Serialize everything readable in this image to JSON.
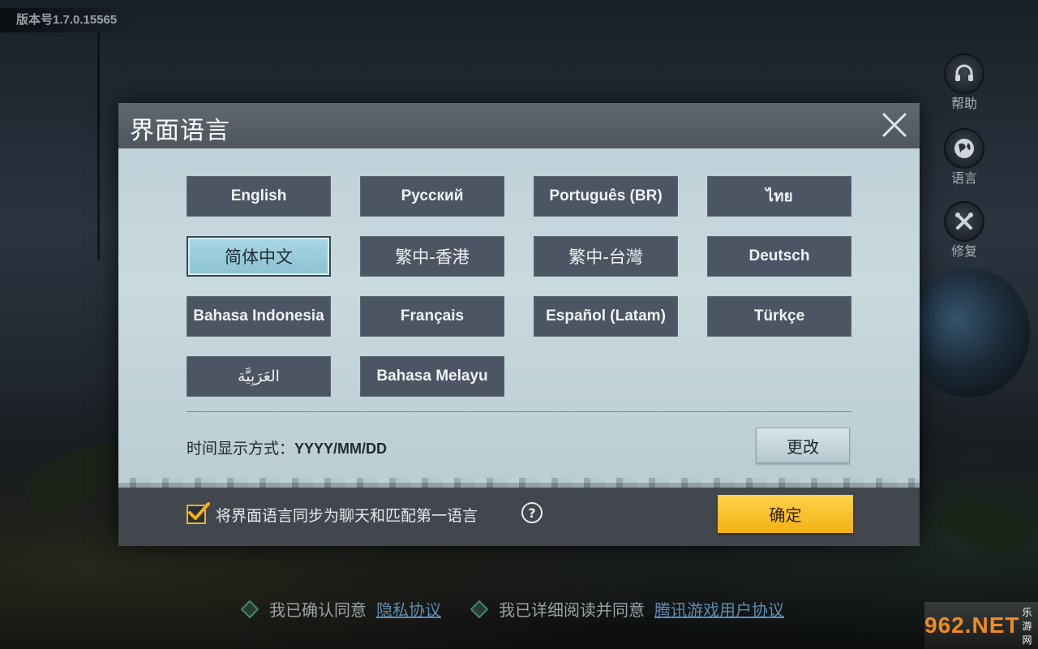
{
  "version": "版本号1.7.0.15565",
  "side_tools": [
    {
      "label": "帮助",
      "icon": "headset-icon"
    },
    {
      "label": "语言",
      "icon": "globe-icon"
    },
    {
      "label": "修复",
      "icon": "wrench-icon"
    }
  ],
  "dialog": {
    "title": "界面语言",
    "languages": [
      {
        "label": "English",
        "selected": false
      },
      {
        "label": "Русский",
        "selected": false
      },
      {
        "label": "Português (BR)",
        "selected": false
      },
      {
        "label": "ไทย",
        "selected": false
      },
      {
        "label": "简体中文",
        "selected": true
      },
      {
        "label": "繁中-香港",
        "selected": false
      },
      {
        "label": "繁中-台灣",
        "selected": false
      },
      {
        "label": "Deutsch",
        "selected": false
      },
      {
        "label": "Bahasa Indonesia",
        "selected": false
      },
      {
        "label": "Français",
        "selected": false
      },
      {
        "label": "Español (Latam)",
        "selected": false
      },
      {
        "label": "Türkçe",
        "selected": false
      },
      {
        "label": "العَرَبِيَّة",
        "selected": false
      },
      {
        "label": "Bahasa Melayu",
        "selected": false
      }
    ],
    "date_format_label": "时间显示方式：",
    "date_format_value": "YYYY/MM/DD",
    "change_label": "更改",
    "sync_label": "将界面语言同步为聊天和匹配第一语言",
    "sync_checked": true,
    "help_symbol": "?",
    "confirm_label": "确定"
  },
  "agreements": [
    {
      "text": "我已确认同意",
      "link": "隐私协议"
    },
    {
      "text": "我已详细阅读并同意",
      "link": "腾讯游戏用户协议"
    }
  ],
  "watermark": {
    "text": "962.NET",
    "sub": "乐游网"
  },
  "colors": {
    "accent": "#f2b112",
    "selected": "#8cc2d2",
    "link": "#5d8db3"
  }
}
